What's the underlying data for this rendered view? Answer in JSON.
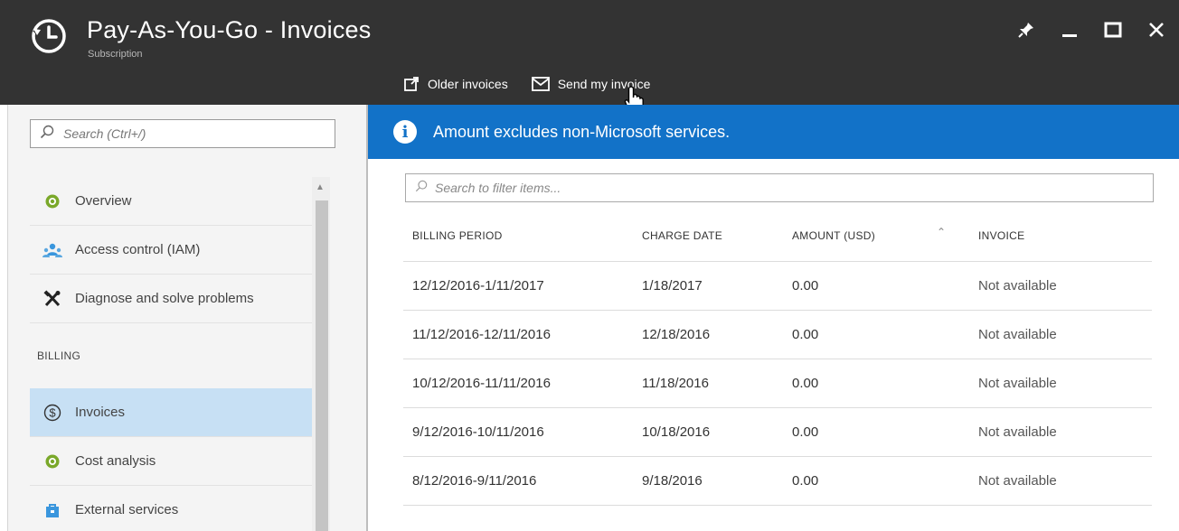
{
  "header": {
    "title": "Pay-As-You-Go - Invoices",
    "subtitle": "Subscription",
    "icon": "history-clock-icon"
  },
  "window_controls": [
    "pin-icon",
    "minimize-icon",
    "maximize-icon",
    "close-icon"
  ],
  "commands": {
    "older_invoices": "Older invoices",
    "send_invoice": "Send my invoice"
  },
  "sidebar": {
    "search_placeholder": "Search (Ctrl+/)",
    "items": [
      {
        "label": "Overview",
        "icon": "overview-icon"
      },
      {
        "label": "Access control (IAM)",
        "icon": "users-icon"
      },
      {
        "label": "Diagnose and solve problems",
        "icon": "tools-icon"
      }
    ],
    "billing_section": "BILLING",
    "billing_items": [
      {
        "label": "Invoices",
        "icon": "dollar-circle-icon",
        "active": true
      },
      {
        "label": "Cost analysis",
        "icon": "cost-icon"
      },
      {
        "label": "External services",
        "icon": "bag-icon"
      }
    ]
  },
  "banner": {
    "message": "Amount excludes non-Microsoft services."
  },
  "grid": {
    "filter_placeholder": "Search to filter items...",
    "columns": [
      "BILLING PERIOD",
      "CHARGE DATE",
      "AMOUNT (USD)",
      "INVOICE"
    ],
    "rows": [
      [
        "12/12/2016-1/11/2017",
        "1/18/2017",
        "0.00",
        "Not available"
      ],
      [
        "11/12/2016-12/11/2016",
        "12/18/2016",
        "0.00",
        "Not available"
      ],
      [
        "10/12/2016-11/11/2016",
        "11/18/2016",
        "0.00",
        "Not available"
      ],
      [
        "9/12/2016-10/11/2016",
        "10/18/2016",
        "0.00",
        "Not available"
      ],
      [
        "8/12/2016-9/11/2016",
        "9/18/2016",
        "0.00",
        "Not available"
      ]
    ]
  },
  "colors": {
    "header_bg": "#333333",
    "banner_bg": "#1272c8",
    "active_item_bg": "#c7e0f4",
    "overview_icon": "#7aa82a"
  }
}
